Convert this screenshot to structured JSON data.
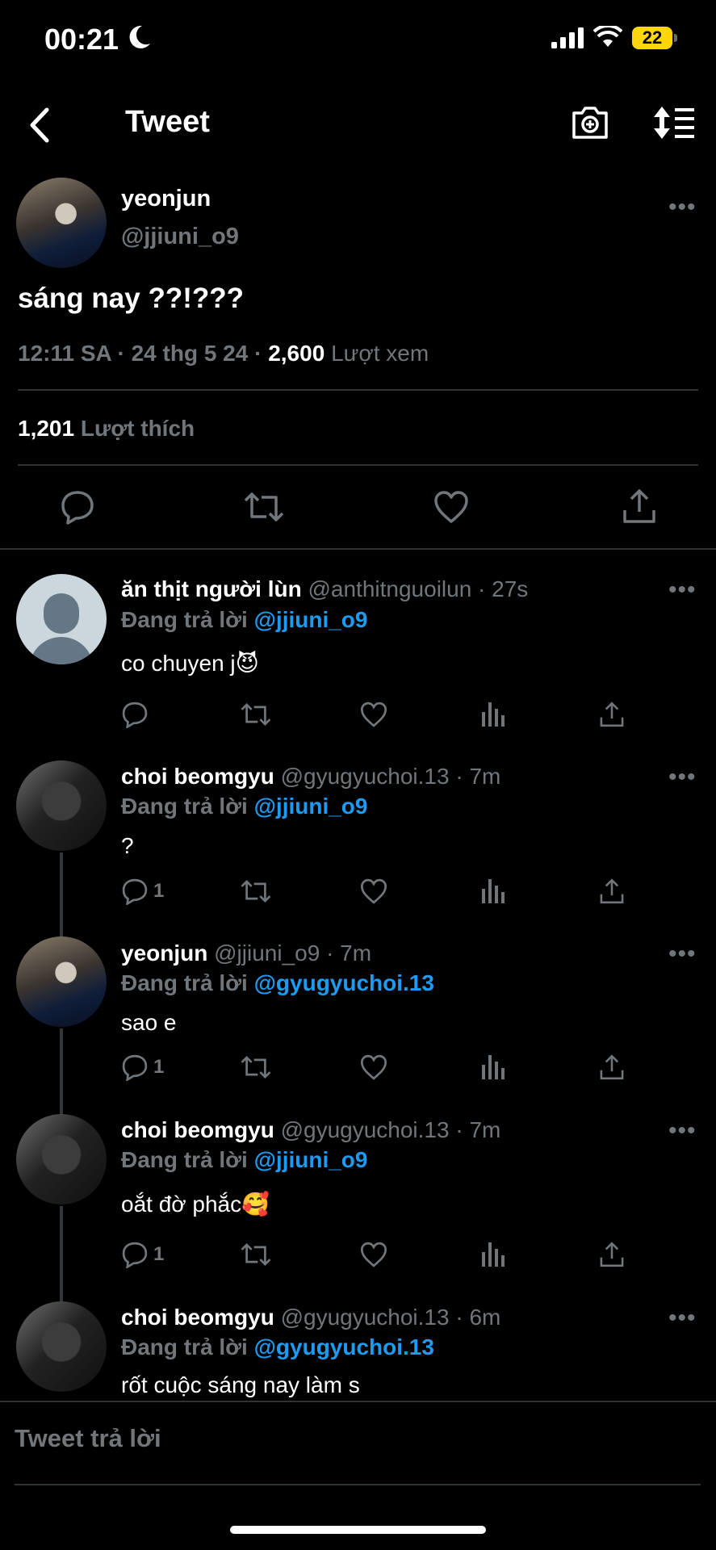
{
  "status": {
    "time": "00:21",
    "battery": "22"
  },
  "header": {
    "title": "Tweet"
  },
  "main_tweet": {
    "name": "yeonjun",
    "handle": "@jjiuni_o9",
    "text": "sáng nay ??!???",
    "time_date": "12:11 SA · 24 thg 5 24 ·",
    "views_count": "2,600",
    "views_label": "Lượt xem",
    "likes_count": "1,201",
    "likes_label": "Lượt thích"
  },
  "replies": [
    {
      "name": "ăn thịt người lùn",
      "meta": "@anthitnguoilun · 27s",
      "replying_label": "Đang trả lời",
      "replying_to": "@jjiuni_o9",
      "text": "co chuyen j😈",
      "reply_count": ""
    },
    {
      "name": "choi beomgyu",
      "meta": "@gyugyuchoi.13 · 7m",
      "replying_label": "Đang trả lời",
      "replying_to": "@jjiuni_o9",
      "text": "?",
      "reply_count": "1"
    },
    {
      "name": "yeonjun",
      "meta": "@jjiuni_o9 · 7m",
      "replying_label": "Đang trả lời",
      "replying_to": "@gyugyuchoi.13",
      "text": "sao e",
      "reply_count": "1"
    },
    {
      "name": "choi beomgyu",
      "meta": "@gyugyuchoi.13 · 7m",
      "replying_label": "Đang trả lời",
      "replying_to": "@jjiuni_o9",
      "text": "oắt đờ phắc🥰",
      "reply_count": "1"
    },
    {
      "name": "choi beomgyu",
      "meta": "@gyugyuchoi.13 · 6m",
      "replying_label": "Đang trả lời",
      "replying_to": "@gyugyuchoi.13",
      "text": "rốt cuộc sáng nay làm s",
      "reply_count": ""
    }
  ],
  "compose": {
    "placeholder": "Tweet trả lời"
  },
  "colors": {
    "background": "#000000",
    "accent": "#1d9bf0",
    "muted": "#71767b",
    "battery": "#ffd60a"
  },
  "icons": [
    "back-icon",
    "camera-plus-icon",
    "sort-icon",
    "reply-icon",
    "retweet-icon",
    "like-icon",
    "share-icon",
    "views-icon",
    "more-icon"
  ]
}
